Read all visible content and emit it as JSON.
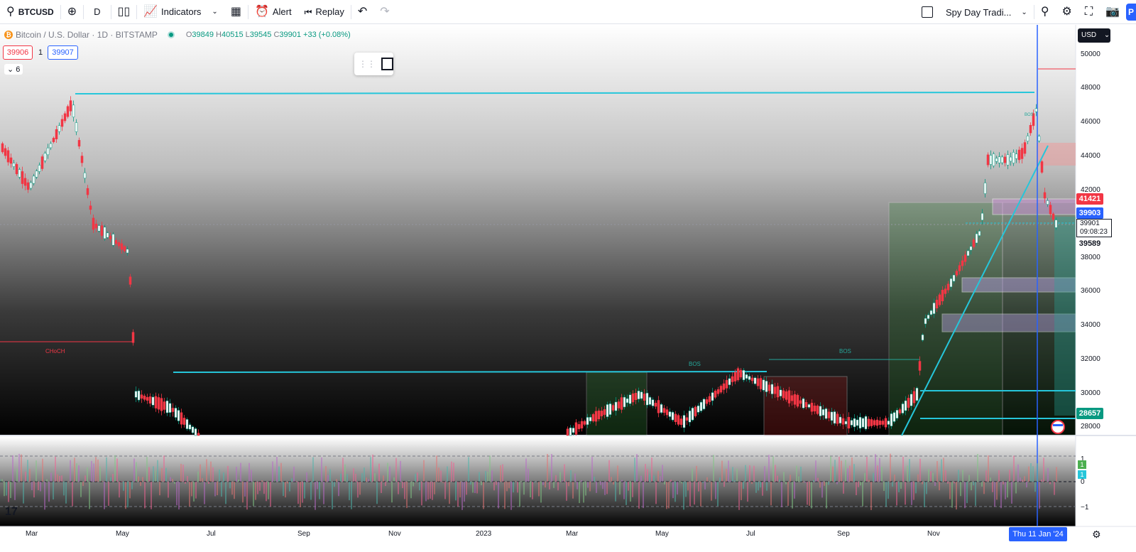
{
  "toolbar": {
    "symbol": "BTCUSD",
    "add_symbol_icon": "plus-circle-icon",
    "interval": "D",
    "chart_style_icon": "candles-icon",
    "indicators_label": "Indicators",
    "layout_icon": "grid-icon",
    "alert_label": "Alert",
    "replay_label": "Replay",
    "undo_icon": "undo-icon",
    "redo_icon": "redo-icon",
    "layout_name": "Spy Day Tradi...",
    "publish_label": "P"
  },
  "legend": {
    "title": "Bitcoin / U.S. Dollar · 1D · BITSTAMP",
    "open_key": "O",
    "open": "39849",
    "high_key": "H",
    "high": "40515",
    "low_key": "L",
    "low": "39545",
    "close_key": "C",
    "close": "39901",
    "change": "+33 (+0.08%)",
    "bid": "39906",
    "spread": "1",
    "ask": "39907",
    "indicators_count": "6"
  },
  "price_axis": {
    "currency": "USD",
    "labels": [
      "50000",
      "48000",
      "46000",
      "44000",
      "42000",
      "38000",
      "36000",
      "34000",
      "32000",
      "30000",
      "28000"
    ],
    "tag_41421": "41421",
    "tag_39903": "39903",
    "last_price": "39901",
    "countdown": "09:08:23",
    "tag_39589": "39589",
    "tag_28657": "28657"
  },
  "oscillator_axis": {
    "label_1": "1",
    "label_0": "0",
    "label_neg1": "−1",
    "tag_green": "1",
    "tag_teal": "1"
  },
  "time_axis": {
    "labels": [
      "Mar",
      "May",
      "Jul",
      "Sep",
      "Nov",
      "2023",
      "Mar",
      "May",
      "Jul",
      "Sep",
      "Nov"
    ],
    "crosshair": "Thu 11 Jan '24"
  },
  "annotations": {
    "choch_left": "CHoCH",
    "bos_label": "BOS",
    "bos_label_2": "BOS",
    "bos_label_3": "BOS"
  },
  "colors": {
    "cyan_line": "#26c6da",
    "up": "#089981",
    "down": "#f23645",
    "accent": "#2962ff"
  }
}
